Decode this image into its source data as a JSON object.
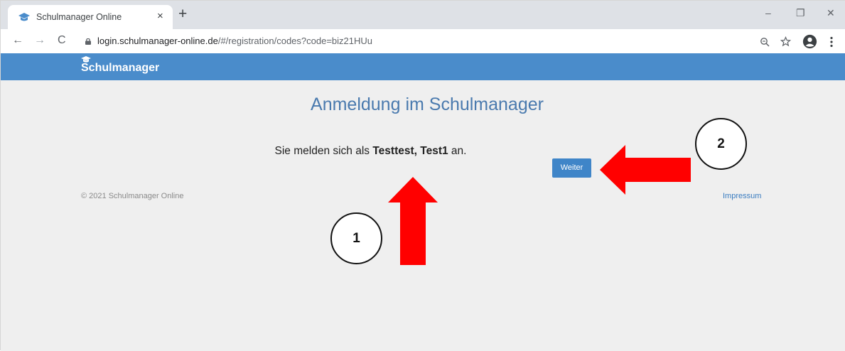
{
  "browser": {
    "tab_title": "Schulmanager Online",
    "tab_close": "×",
    "new_tab": "+",
    "url_domain": "login.schulmanager-online.de",
    "url_path": "/#/registration/codes?code=biz21HUu",
    "window_controls": {
      "minimize": "–",
      "restore": "❐",
      "close": "✕"
    },
    "nav": {
      "back": "←",
      "forward": "→",
      "reload": "C"
    }
  },
  "app": {
    "brand": "Schulmanager",
    "brand_color": "#4a8ccb"
  },
  "main": {
    "title": "Anmeldung im Schulmanager",
    "sentence_prefix": "Sie melden sich als ",
    "user_name": "Testtest, Test1",
    "sentence_suffix": " an.",
    "continue_button": "Weiter"
  },
  "footer": {
    "copyright": "© 2021 Schulmanager Online",
    "impressum": "Impressum"
  },
  "annotations": {
    "badge_1": "1",
    "badge_2": "2",
    "arrow_color": "#ff0000"
  }
}
